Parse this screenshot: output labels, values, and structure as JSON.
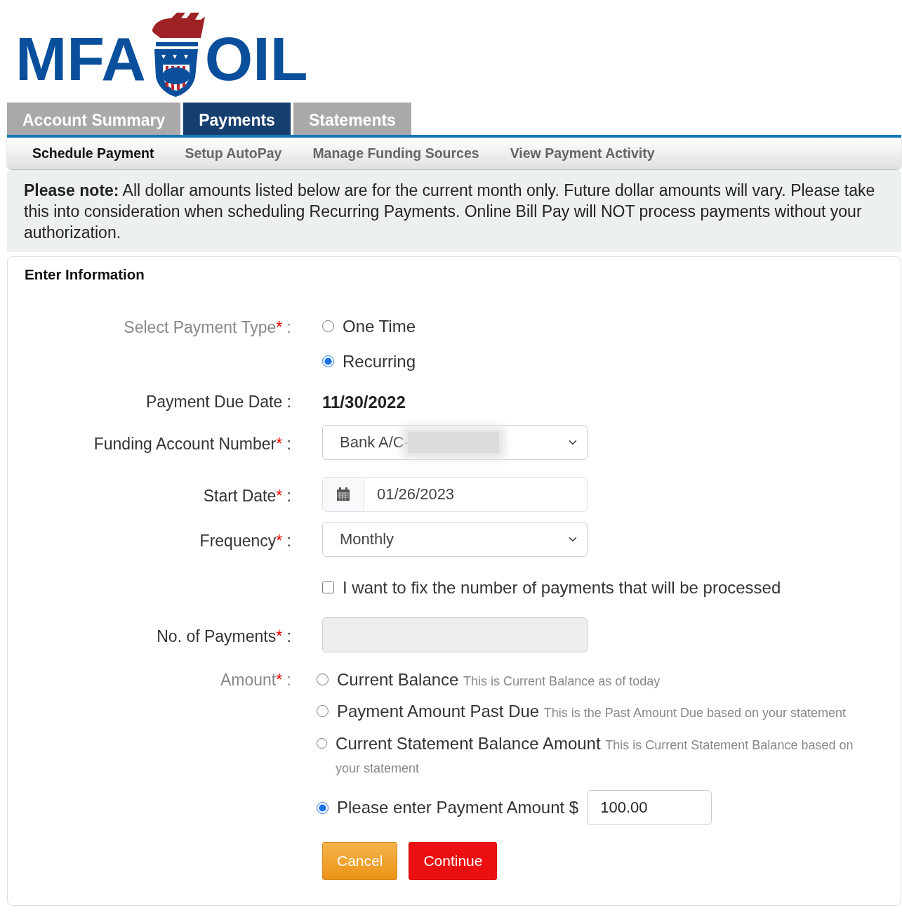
{
  "logo": {
    "left": "MFA",
    "right": "OIL"
  },
  "tabs": [
    {
      "label": "Account Summary",
      "selected": false
    },
    {
      "label": "Payments",
      "selected": true
    },
    {
      "label": "Statements",
      "selected": false
    }
  ],
  "subnav": [
    {
      "label": "Schedule Payment",
      "selected": true
    },
    {
      "label": "Setup AutoPay",
      "selected": false
    },
    {
      "label": "Manage Funding Sources",
      "selected": false
    },
    {
      "label": "View Payment Activity",
      "selected": false
    }
  ],
  "notice": "**Please note:** All dollar amounts listed below are for the current month only. Future dollar amounts will vary. Please take this into consideration when scheduling Recurring Payments. Online Bill Pay will NOT process payments without your authorization.",
  "form": {
    "title": "Enter Information",
    "rows": [
      {
        "kind": "radios",
        "label": "Select Payment Type",
        "required_mark": "*",
        "separator": ":",
        "dimmed": true,
        "options": [
          {
            "label": "One Time",
            "selected": false
          },
          {
            "label": "Recurring",
            "selected": true
          }
        ]
      },
      {
        "kind": "static",
        "label": "Payment Due Date",
        "separator": ":",
        "dimmed": false,
        "value": "11/30/2022"
      },
      {
        "kind": "select",
        "label": "Funding Account Number",
        "required_mark": "*",
        "separator": ":",
        "dimmed": false,
        "value": "Bank A/C-",
        "redacted": true
      },
      {
        "kind": "date",
        "label": "Start Date",
        "required_mark": "*",
        "separator": ":",
        "dimmed": false,
        "value": "01/26/2023"
      },
      {
        "kind": "select",
        "label": "Frequency",
        "required_mark": "*",
        "separator": ":",
        "dimmed": false,
        "value": "Monthly"
      },
      {
        "kind": "checkbox",
        "text": "I want to fix the number of payments that will be processed",
        "checked": false
      },
      {
        "kind": "input",
        "label": "No. of Payments",
        "required_mark": "*",
        "separator": ":",
        "dimmed": false,
        "disabled": true
      },
      {
        "kind": "amount",
        "label": "Amount",
        "required_mark": "*",
        "separator": ":",
        "dimmed": true,
        "options": [
          {
            "label": "Current Balance",
            "hint": "This is Current Balance as of today",
            "selected": false
          },
          {
            "label": "Payment Amount Past Due",
            "hint": "This is the Past Amount Due based on your statement",
            "selected": false
          },
          {
            "label": "Current Statement Balance Amount",
            "hint": "This is Current Statement Balance based on your statement",
            "selected": false
          },
          {
            "label": "Please enter Payment Amount $",
            "value": "100.00",
            "selected": true
          }
        ]
      }
    ],
    "buttons": [
      {
        "label": "Cancel",
        "kind": "warning"
      },
      {
        "label": "Continue",
        "kind": "danger"
      }
    ]
  }
}
